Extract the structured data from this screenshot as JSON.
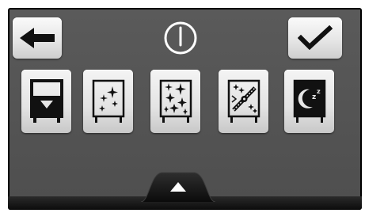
{
  "header": {
    "back_icon": "arrow-left-icon",
    "power_icon": "power-icon",
    "confirm_icon": "checkmark-icon"
  },
  "programs": [
    {
      "name": "drain-program",
      "icon": "oven-drain-icon"
    },
    {
      "name": "sparkle-program",
      "icon": "oven-sparkle-icon"
    },
    {
      "name": "intensive-sparkle-program",
      "icon": "oven-sparkle-intensive-icon"
    },
    {
      "name": "fan-sparkle-program",
      "icon": "oven-fan-sparkle-icon"
    },
    {
      "name": "sleep-program",
      "icon": "oven-sleep-icon"
    }
  ],
  "footer": {
    "expand_icon": "triangle-up-icon"
  },
  "colors": {
    "panel": "#555555",
    "button_face": "#e6e6e6",
    "icon_dark": "#111111",
    "power_white": "#ffffff"
  }
}
